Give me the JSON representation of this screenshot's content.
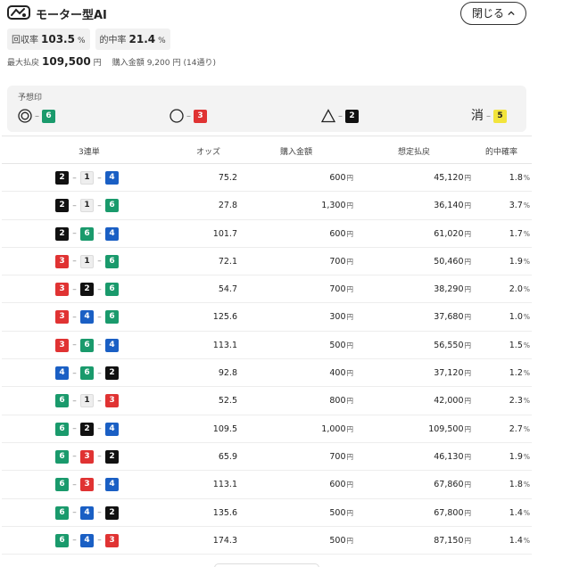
{
  "header": {
    "title": "モーター型AI",
    "close_label": "閉じる"
  },
  "icons": {
    "logo": "motor-logo-icon",
    "close": "chevron-up-icon",
    "predict_1": "double-circle-icon",
    "predict_2": "circle-icon",
    "predict_3": "triangle-icon"
  },
  "stats": {
    "recovery_label": "回収率",
    "recovery_value": "103.5",
    "recovery_unit": "%",
    "hit_label": "的中率",
    "hit_value": "21.4",
    "hit_unit": "%"
  },
  "summary": {
    "max_label": "最大払戻",
    "max_value": "109,500",
    "max_unit": "円",
    "purchase_label": "購入金額",
    "purchase_value": "9,200",
    "purchase_unit": "円",
    "purchase_count": "(14通り)"
  },
  "prediction": {
    "label": "予想印",
    "items": [
      {
        "mark": "◎",
        "boat": "6"
      },
      {
        "mark": "○",
        "boat": "3"
      },
      {
        "mark": "△",
        "boat": "2"
      },
      {
        "mark": "消",
        "boat": "5"
      }
    ]
  },
  "colors": {
    "boat1": "#eeeeee",
    "boat2": "#111111",
    "boat3": "#e03333",
    "boat4": "#1a5fc4",
    "boat5": "#f2e43c",
    "boat6": "#1a9a6c"
  },
  "table": {
    "headers": {
      "combo": "3連単",
      "odds": "オッズ",
      "amount": "購入金額",
      "payout": "想定払戻",
      "prob": "的中確率"
    },
    "yen": "円",
    "pct": "%",
    "dash": "–",
    "rows": [
      {
        "b": [
          "2",
          "1",
          "4"
        ],
        "odds": "75.2",
        "amount": "600",
        "payout": "45,120",
        "prob": "1.8"
      },
      {
        "b": [
          "2",
          "1",
          "6"
        ],
        "odds": "27.8",
        "amount": "1,300",
        "payout": "36,140",
        "prob": "3.7"
      },
      {
        "b": [
          "2",
          "6",
          "4"
        ],
        "odds": "101.7",
        "amount": "600",
        "payout": "61,020",
        "prob": "1.7"
      },
      {
        "b": [
          "3",
          "1",
          "6"
        ],
        "odds": "72.1",
        "amount": "700",
        "payout": "50,460",
        "prob": "1.9"
      },
      {
        "b": [
          "3",
          "2",
          "6"
        ],
        "odds": "54.7",
        "amount": "700",
        "payout": "38,290",
        "prob": "2.0"
      },
      {
        "b": [
          "3",
          "4",
          "6"
        ],
        "odds": "125.6",
        "amount": "300",
        "payout": "37,680",
        "prob": "1.0"
      },
      {
        "b": [
          "3",
          "6",
          "4"
        ],
        "odds": "113.1",
        "amount": "500",
        "payout": "56,550",
        "prob": "1.5"
      },
      {
        "b": [
          "4",
          "6",
          "2"
        ],
        "odds": "92.8",
        "amount": "400",
        "payout": "37,120",
        "prob": "1.2"
      },
      {
        "b": [
          "6",
          "1",
          "3"
        ],
        "odds": "52.5",
        "amount": "800",
        "payout": "42,000",
        "prob": "2.3"
      },
      {
        "b": [
          "6",
          "2",
          "4"
        ],
        "odds": "109.5",
        "amount": "1,000",
        "payout": "109,500",
        "prob": "2.7"
      },
      {
        "b": [
          "6",
          "3",
          "2"
        ],
        "odds": "65.9",
        "amount": "700",
        "payout": "46,130",
        "prob": "1.9"
      },
      {
        "b": [
          "6",
          "3",
          "4"
        ],
        "odds": "113.1",
        "amount": "600",
        "payout": "67,860",
        "prob": "1.8"
      },
      {
        "b": [
          "6",
          "4",
          "2"
        ],
        "odds": "135.6",
        "amount": "500",
        "payout": "67,800",
        "prob": "1.4"
      },
      {
        "b": [
          "6",
          "4",
          "3"
        ],
        "odds": "174.3",
        "amount": "500",
        "payout": "87,150",
        "prob": "1.4"
      }
    ]
  }
}
